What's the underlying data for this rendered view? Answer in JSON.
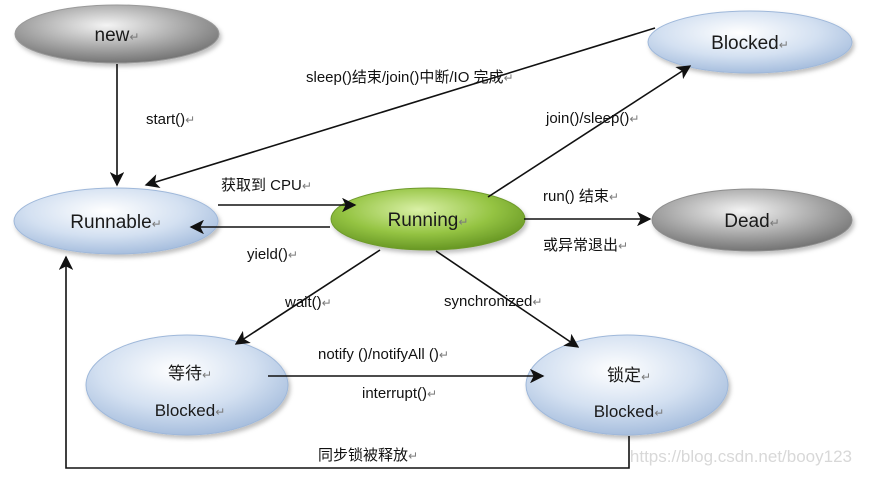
{
  "para_mark": "↵",
  "colors": {
    "blue_state": "#bcd0ea",
    "green_state": "#8fbc3b",
    "gray_state": "#8a8a8a",
    "arrow": "#111111"
  },
  "states": {
    "new": "new",
    "blocked_top": "Blocked",
    "runnable": "Runnable",
    "running": "Running",
    "dead": "Dead",
    "wait_title": "等待",
    "wait_sub": "Blocked",
    "lock_title": "锁定",
    "lock_sub": "Blocked"
  },
  "transitions": {
    "start": "start()",
    "sleep_end": "sleep()结束/join()中断/IO 完成",
    "join_sleep": "join()/sleep()",
    "get_cpu": "获取到 CPU",
    "yield": "yield()",
    "run_end": "run()  结束",
    "exception_exit": "或异常退出",
    "wait": "wait()",
    "synchronized": "synchronized",
    "notify": "notify ()/notifyAll ()",
    "interrupt": "interrupt()",
    "lock_released": "同步锁被释放"
  },
  "watermark": "https://blog.csdn.net/booy123"
}
